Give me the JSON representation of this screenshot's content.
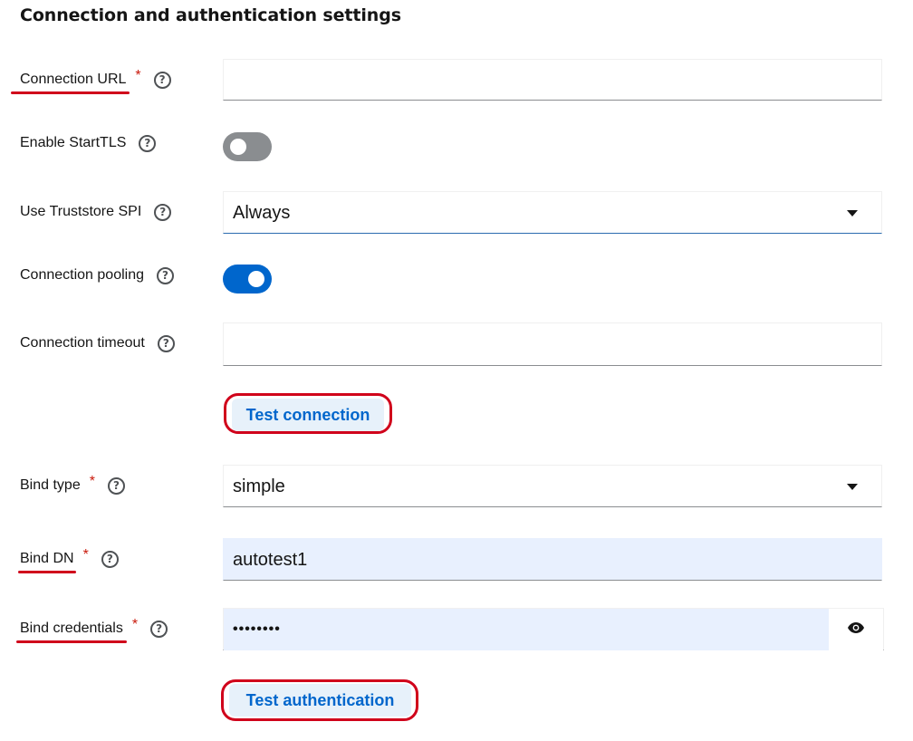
{
  "section": {
    "title": "Connection and authentication settings"
  },
  "fields": {
    "connection_url": {
      "label": "Connection URL",
      "required": "*",
      "value": ""
    },
    "enable_starttls": {
      "label": "Enable StartTLS",
      "state": "off"
    },
    "use_truststore_spi": {
      "label": "Use Truststore SPI",
      "value": "Always"
    },
    "connection_pooling": {
      "label": "Connection pooling",
      "state": "on"
    },
    "connection_timeout": {
      "label": "Connection timeout",
      "value": ""
    },
    "bind_type": {
      "label": "Bind type",
      "required": "*",
      "value": "simple"
    },
    "bind_dn": {
      "label": "Bind DN",
      "required": "*",
      "value": "autotest1"
    },
    "bind_credentials": {
      "label": "Bind credentials",
      "required": "*",
      "value": "••••••••"
    }
  },
  "buttons": {
    "test_connection": "Test connection",
    "test_authentication": "Test authentication"
  },
  "icons": {
    "help": "help-icon",
    "dropdown": "caret-down-icon",
    "show_password": "eye-icon"
  },
  "colors": {
    "accent": "#0066cc",
    "annotation": "#d0021b",
    "toggle_off": "#8a8d90",
    "autofill_bg": "#e8f0fe"
  }
}
